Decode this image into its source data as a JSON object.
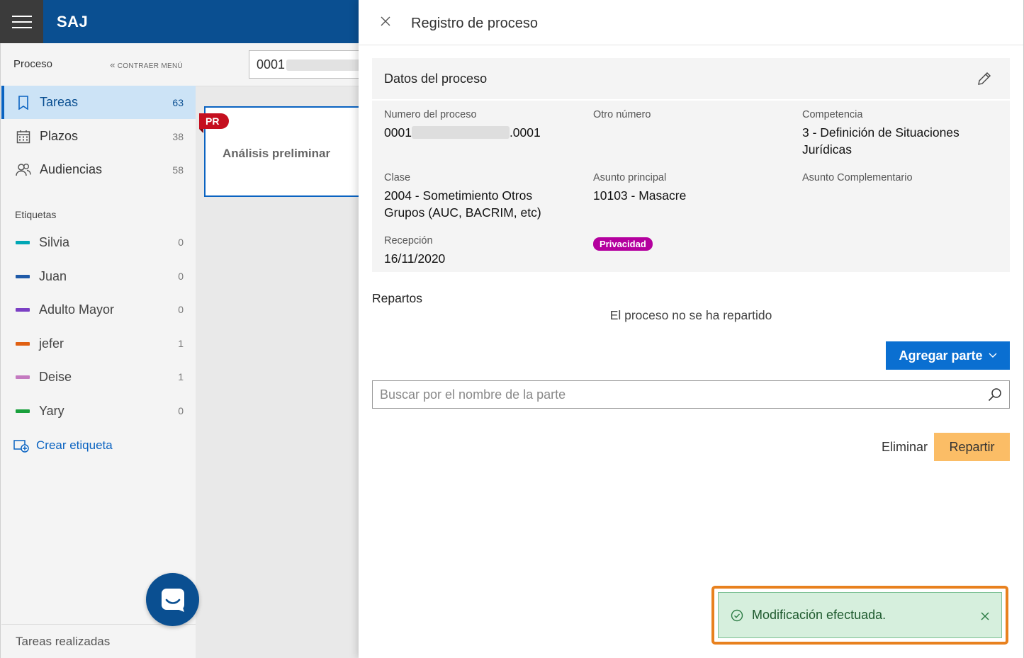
{
  "app": {
    "title": "SAJ"
  },
  "sidebar": {
    "header": "Proceso",
    "collapse_label": "CONTRAER MENÚ",
    "nav": [
      {
        "label": "Tareas",
        "count": "63",
        "icon": "bookmark-icon",
        "active": true
      },
      {
        "label": "Plazos",
        "count": "38",
        "icon": "calendar-icon",
        "active": false
      },
      {
        "label": "Audiencias",
        "count": "58",
        "icon": "people-icon",
        "active": false
      }
    ],
    "tags_label": "Etiquetas",
    "tags": [
      {
        "label": "Silvia",
        "count": "0",
        "color": "#00a7b5"
      },
      {
        "label": "Juan",
        "count": "0",
        "color": "#1f5aa8"
      },
      {
        "label": "Adulto Mayor",
        "count": "0",
        "color": "#7b3fc4"
      },
      {
        "label": "jefer",
        "count": "1",
        "color": "#e06012"
      },
      {
        "label": "Deise",
        "count": "1",
        "color": "#c47ac0"
      },
      {
        "label": "Yary",
        "count": "0",
        "color": "#19a03c"
      }
    ],
    "create_tag_label": "Crear etiqueta",
    "footer_label": "Tareas realizadas"
  },
  "middle": {
    "process_input_value": "0001",
    "card": {
      "badge": "PR",
      "title": "Análisis preliminar"
    }
  },
  "panel": {
    "title": "Registro de proceso",
    "data_title": "Datos del proceso",
    "fields": {
      "numero_label": "Numero del proceso",
      "numero_prefix": "0001",
      "numero_suffix": ".0001",
      "otro_label": "Otro número",
      "competencia_label": "Competencia",
      "competencia_value": "3 - Definición de Situaciones Jurídicas",
      "clase_label": "Clase",
      "clase_value": "2004 - Sometimiento Otros Grupos (AUC, BACRIM, etc)",
      "asunto_label": "Asunto principal",
      "asunto_value": "10103 - Masacre",
      "complementario_label": "Asunto Complementario",
      "recepcion_label": "Recepción",
      "recepcion_value": "16/11/2020",
      "privacy_badge": "Privacidad"
    },
    "repartos_title": "Repartos",
    "repartos_empty": "El proceso no se ha repartido",
    "add_part_label": "Agregar parte",
    "search_placeholder": "Buscar por el nombre de la parte",
    "delete_label": "Eliminar",
    "split_label": "Repartir",
    "toast_message": "Modificación efectuada."
  }
}
